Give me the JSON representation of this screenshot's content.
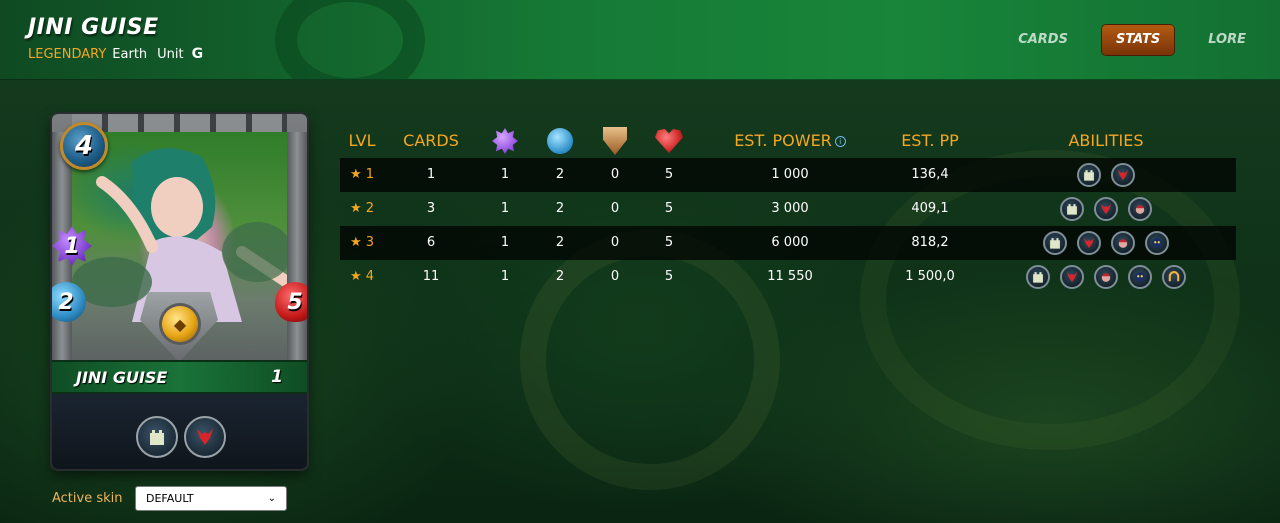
{
  "header": {
    "title": "JINI GUISE",
    "rarity": "LEGENDARY",
    "element": "Earth",
    "type": "Unit",
    "edition_glyph": "G",
    "nav": [
      {
        "label": "CARDS",
        "active": false
      },
      {
        "label": "STATS",
        "active": true
      },
      {
        "label": "LORE",
        "active": false
      }
    ]
  },
  "card": {
    "name": "JINI GUISE",
    "level": "1",
    "mana": "4",
    "magic": "1",
    "speed": "2",
    "health": "5",
    "abilities": [
      "fortress-icon",
      "demon-icon"
    ]
  },
  "skin": {
    "label": "Active skin",
    "selected": "DEFAULT"
  },
  "table": {
    "headers": {
      "lvl": "LVL",
      "cards": "CARDS",
      "magic_icon": "magic-icon",
      "speed_icon": "speed-icon",
      "armor_icon": "armor-icon",
      "health_icon": "health-icon",
      "est_power": "EST. POWER",
      "est_pp": "EST. PP",
      "abilities": "ABILITIES"
    },
    "rows": [
      {
        "lvl": "★ 1",
        "cards": "1",
        "magic": "1",
        "speed": "2",
        "armor": "0",
        "health": "5",
        "est_power": "1 000",
        "est_pp": "136,4",
        "abilities": [
          "fortress-icon",
          "demon-icon"
        ]
      },
      {
        "lvl": "★ 2",
        "cards": "3",
        "magic": "1",
        "speed": "2",
        "armor": "0",
        "health": "5",
        "est_power": "3 000",
        "est_pp": "409,1",
        "abilities": [
          "fortress-icon",
          "demon-icon",
          "strike-icon"
        ]
      },
      {
        "lvl": "★ 3",
        "cards": "6",
        "magic": "1",
        "speed": "2",
        "armor": "0",
        "health": "5",
        "est_power": "6 000",
        "est_pp": "818,2",
        "abilities": [
          "fortress-icon",
          "demon-icon",
          "strike-icon",
          "shadow-icon"
        ]
      },
      {
        "lvl": "★ 4",
        "cards": "11",
        "magic": "1",
        "speed": "2",
        "armor": "0",
        "health": "5",
        "est_power": "11 550",
        "est_pp": "1 500,0",
        "abilities": [
          "fortress-icon",
          "demon-icon",
          "strike-icon",
          "shadow-icon",
          "shield-ring-icon"
        ]
      }
    ]
  },
  "colors": {
    "accent": "#f5a623",
    "nav_active": "#9b4a0d",
    "header_green": "#167a36"
  }
}
